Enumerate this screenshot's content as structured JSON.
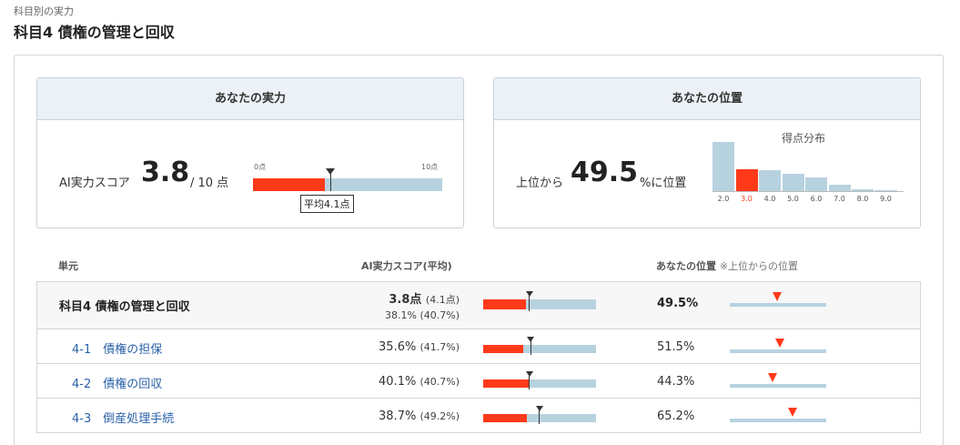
{
  "breadcrumb": "科目別の実力",
  "page_title": "科目4 債権の管理と回収",
  "card_ability": {
    "heading": "あなたの実力",
    "label": "AI実力スコア",
    "score": "3.8",
    "unit": "/ 10 点",
    "bar_min_label": "0点",
    "bar_max_label": "10点",
    "bar_max": 10,
    "avg_value": 4.1,
    "avg_label": "平均4.1点"
  },
  "card_position": {
    "heading": "あなたの位置",
    "prefix": "上位から",
    "value": "49.5",
    "suffix": "%に位置",
    "histogram_title": "得点分布",
    "histogram": {
      "ticks": [
        "2.0",
        "3.0",
        "4.0",
        "5.0",
        "6.0",
        "7.0",
        "8.0",
        "9.0"
      ],
      "heights": [
        1.0,
        0.44,
        0.42,
        0.35,
        0.27,
        0.13,
        0.04,
        0.01
      ],
      "highlight_index": 1,
      "highlight_color": "#ff3a1a",
      "bar_color": "#b7d2df"
    }
  },
  "table": {
    "col_unit": "単元",
    "col_score": "AI実力スコア(平均)",
    "col_position": "あなたの位置",
    "col_position_note": "※上位からの位置",
    "rows": [
      {
        "name": "科目4 債権の管理と回収",
        "score_main": "3.8点",
        "score_avg": "(4.1点)",
        "pct": "38.1%",
        "pct_avg": "(40.7%)",
        "value": 0.381,
        "avg": 0.407,
        "position": "49.5%",
        "pos_value": 0.495
      },
      {
        "name": "4-1　債権の担保",
        "score_main": "35.6%",
        "score_avg": "(41.7%)",
        "value": 0.356,
        "avg": 0.417,
        "position": "51.5%",
        "pos_value": 0.515
      },
      {
        "name": "4-2　債権の回収",
        "score_main": "40.1%",
        "score_avg": "(40.7%)",
        "value": 0.401,
        "avg": 0.407,
        "position": "44.3%",
        "pos_value": 0.443
      },
      {
        "name": "4-3　倒産処理手続",
        "score_main": "38.7%",
        "score_avg": "(49.2%)",
        "value": 0.387,
        "avg": 0.492,
        "position": "65.2%",
        "pos_value": 0.652
      }
    ]
  },
  "colors": {
    "accent": "#ff3a1a",
    "bar": "#b7d2df",
    "link": "#2a62a8",
    "header_bg": "#ebf1f6"
  }
}
